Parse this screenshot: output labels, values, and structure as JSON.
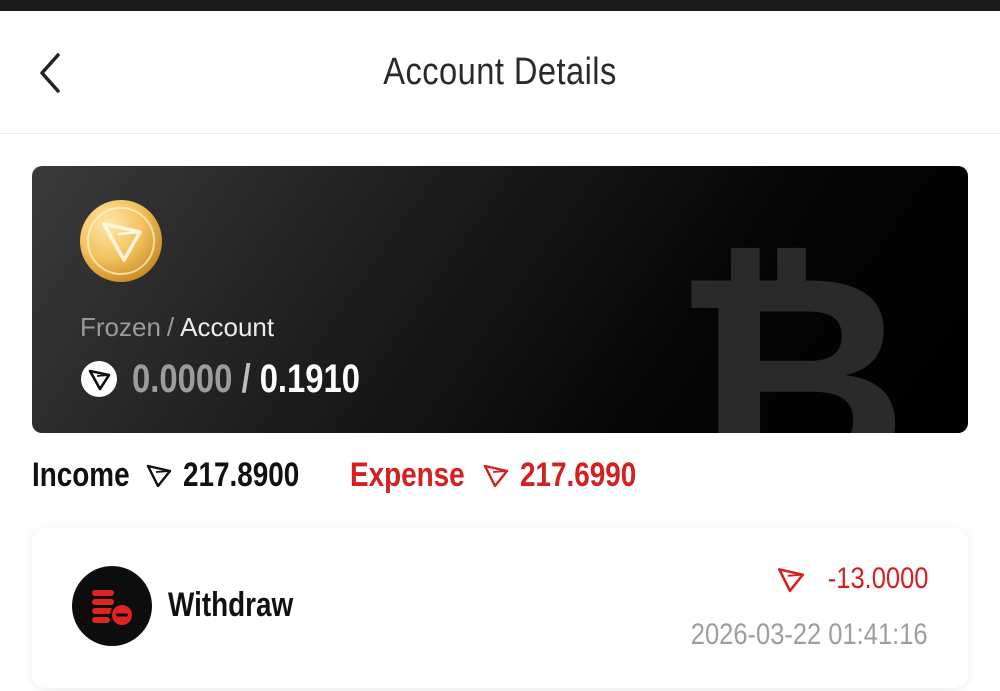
{
  "header": {
    "title": "Account Details"
  },
  "balance_card": {
    "frozen_label": "Frozen",
    "separator": "/",
    "account_label": "Account",
    "frozen_value": "0.0000",
    "value_separator": "/",
    "account_value": "0.1910"
  },
  "summary": {
    "income_label": "Income",
    "income_value": "217.8900",
    "expense_label": "Expense",
    "expense_value": "217.6990"
  },
  "transactions": [
    {
      "type": "Withdraw",
      "amount": "-13.0000",
      "timestamp": "2026-03-22 01:41:16"
    }
  ],
  "colors": {
    "accent_red": "#d32121",
    "card_dark": "#1c1c1c",
    "coin_gold": "#f0c060"
  },
  "icons": {
    "back": "chevron-left-icon",
    "coin": "tron-coin-icon",
    "currency": "tron-icon",
    "watermark": "bitcoin-icon",
    "withdraw": "withdraw-coins-icon"
  }
}
